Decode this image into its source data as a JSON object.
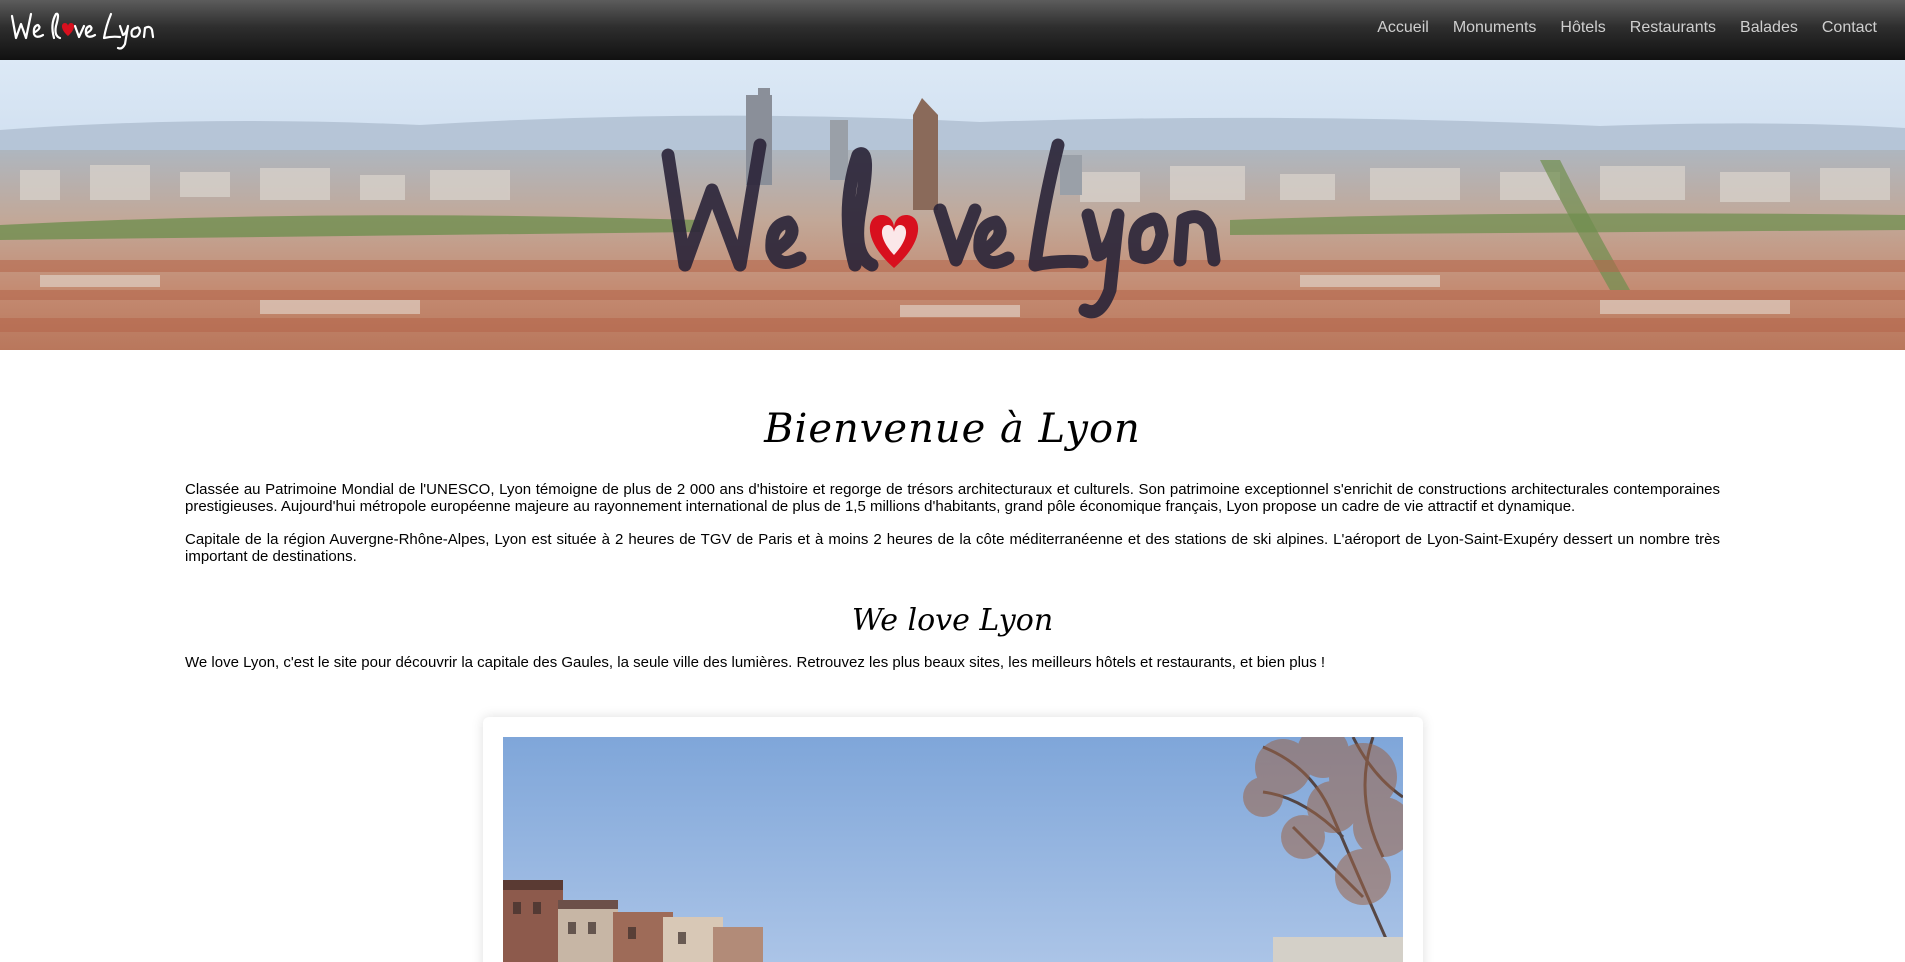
{
  "brand": {
    "logo_text": "We love Lyon",
    "logo_icon": "heart-icon"
  },
  "nav": {
    "items": [
      {
        "label": "Accueil"
      },
      {
        "label": "Monuments"
      },
      {
        "label": "Hôtels"
      },
      {
        "label": "Restaurants"
      },
      {
        "label": "Balades"
      },
      {
        "label": "Contact"
      }
    ]
  },
  "hero": {
    "overlay_text": "We love Lyon",
    "overlay_icon": "heart-icon"
  },
  "main": {
    "title": "Bienvenue à Lyon",
    "paragraphs": [
      "Classée au Patrimoine Mondial de l'UNESCO, Lyon témoigne de plus de 2 000 ans d'histoire et regorge de trésors architecturaux et culturels. Son patrimoine exceptionnel s'enrichit de constructions architecturales contemporaines prestigieuses. Aujourd'hui métropole européenne majeure au rayonnement international de plus de 1,5 millions d'habitants, grand pôle économique français, Lyon propose un cadre de vie attractif et dynamique.",
      "Capitale de la région Auvergne-Rhône-Alpes, Lyon est située à 2 heures de TGV de Paris et à moins 2 heures de la côte méditerranéenne et des stations de ski alpines. L'aéroport de Lyon-Saint-Exupéry dessert un nombre très important de destinations."
    ],
    "subtitle": "We love Lyon",
    "intro": "We love Lyon, c'est le site pour découvrir la capitale des Gaules, la seule ville des lumières. Retrouvez les plus beaux sites, les meilleurs hôtels et restaurants, et bien plus !"
  },
  "colors": {
    "navbar_top": "#5c5c5c",
    "navbar_bottom": "#111111",
    "nav_text": "#cfcfcf",
    "heart": "#d8101e",
    "sky": "#9bbde6"
  }
}
